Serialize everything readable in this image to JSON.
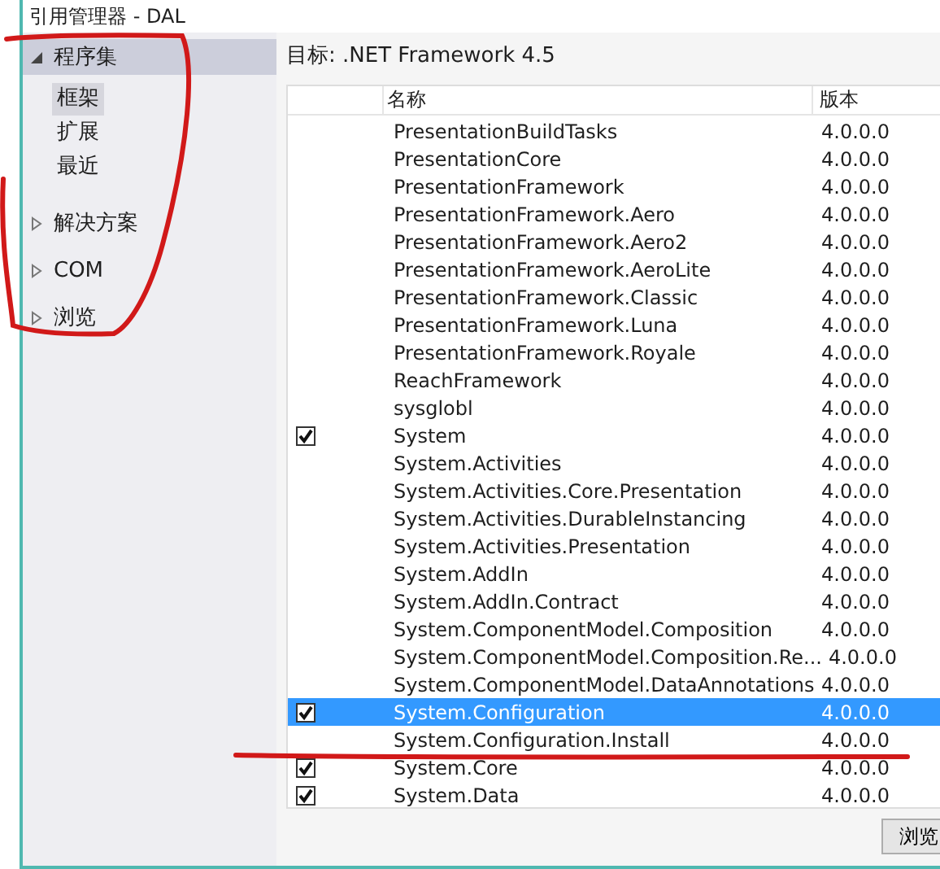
{
  "window": {
    "title": "引用管理器 - DAL"
  },
  "sidebar": {
    "items": [
      {
        "label": "程序集",
        "expanded": true,
        "selected": true,
        "children": [
          {
            "label": "框架",
            "selected": true
          },
          {
            "label": "扩展",
            "selected": false
          },
          {
            "label": "最近",
            "selected": false
          }
        ]
      },
      {
        "label": "解决方案",
        "expanded": false,
        "selected": false
      },
      {
        "label": "COM",
        "expanded": false,
        "selected": false
      },
      {
        "label": "浏览",
        "expanded": false,
        "selected": false
      }
    ]
  },
  "target": "目标: .NET Framework 4.5",
  "table": {
    "columns": [
      "名称",
      "版本"
    ],
    "rows": [
      {
        "name": "PresentationBuildTasks",
        "version": "4.0.0.0",
        "checked": false,
        "selected": false
      },
      {
        "name": "PresentationCore",
        "version": "4.0.0.0",
        "checked": false,
        "selected": false
      },
      {
        "name": "PresentationFramework",
        "version": "4.0.0.0",
        "checked": false,
        "selected": false
      },
      {
        "name": "PresentationFramework.Aero",
        "version": "4.0.0.0",
        "checked": false,
        "selected": false
      },
      {
        "name": "PresentationFramework.Aero2",
        "version": "4.0.0.0",
        "checked": false,
        "selected": false
      },
      {
        "name": "PresentationFramework.AeroLite",
        "version": "4.0.0.0",
        "checked": false,
        "selected": false
      },
      {
        "name": "PresentationFramework.Classic",
        "version": "4.0.0.0",
        "checked": false,
        "selected": false
      },
      {
        "name": "PresentationFramework.Luna",
        "version": "4.0.0.0",
        "checked": false,
        "selected": false
      },
      {
        "name": "PresentationFramework.Royale",
        "version": "4.0.0.0",
        "checked": false,
        "selected": false
      },
      {
        "name": "ReachFramework",
        "version": "4.0.0.0",
        "checked": false,
        "selected": false
      },
      {
        "name": "sysglobl",
        "version": "4.0.0.0",
        "checked": false,
        "selected": false
      },
      {
        "name": "System",
        "version": "4.0.0.0",
        "checked": true,
        "selected": false
      },
      {
        "name": "System.Activities",
        "version": "4.0.0.0",
        "checked": false,
        "selected": false
      },
      {
        "name": "System.Activities.Core.Presentation",
        "version": "4.0.0.0",
        "checked": false,
        "selected": false
      },
      {
        "name": "System.Activities.DurableInstancing",
        "version": "4.0.0.0",
        "checked": false,
        "selected": false
      },
      {
        "name": "System.Activities.Presentation",
        "version": "4.0.0.0",
        "checked": false,
        "selected": false
      },
      {
        "name": "System.AddIn",
        "version": "4.0.0.0",
        "checked": false,
        "selected": false
      },
      {
        "name": "System.AddIn.Contract",
        "version": "4.0.0.0",
        "checked": false,
        "selected": false
      },
      {
        "name": "System.ComponentModel.Composition",
        "version": "4.0.0.0",
        "checked": false,
        "selected": false
      },
      {
        "name": "System.ComponentModel.Composition.Re...",
        "version": "4.0.0.0",
        "checked": false,
        "selected": false
      },
      {
        "name": "System.ComponentModel.DataAnnotations",
        "version": "4.0.0.0",
        "checked": false,
        "selected": false
      },
      {
        "name": "System.Configuration",
        "version": "4.0.0.0",
        "checked": true,
        "selected": true
      },
      {
        "name": "System.Configuration.Install",
        "version": "4.0.0.0",
        "checked": false,
        "selected": false
      },
      {
        "name": "System.Core",
        "version": "4.0.0.0",
        "checked": true,
        "selected": false
      },
      {
        "name": "System.Data",
        "version": "4.0.0.0",
        "checked": true,
        "selected": false
      }
    ]
  },
  "buttons": [
    "浏览"
  ]
}
